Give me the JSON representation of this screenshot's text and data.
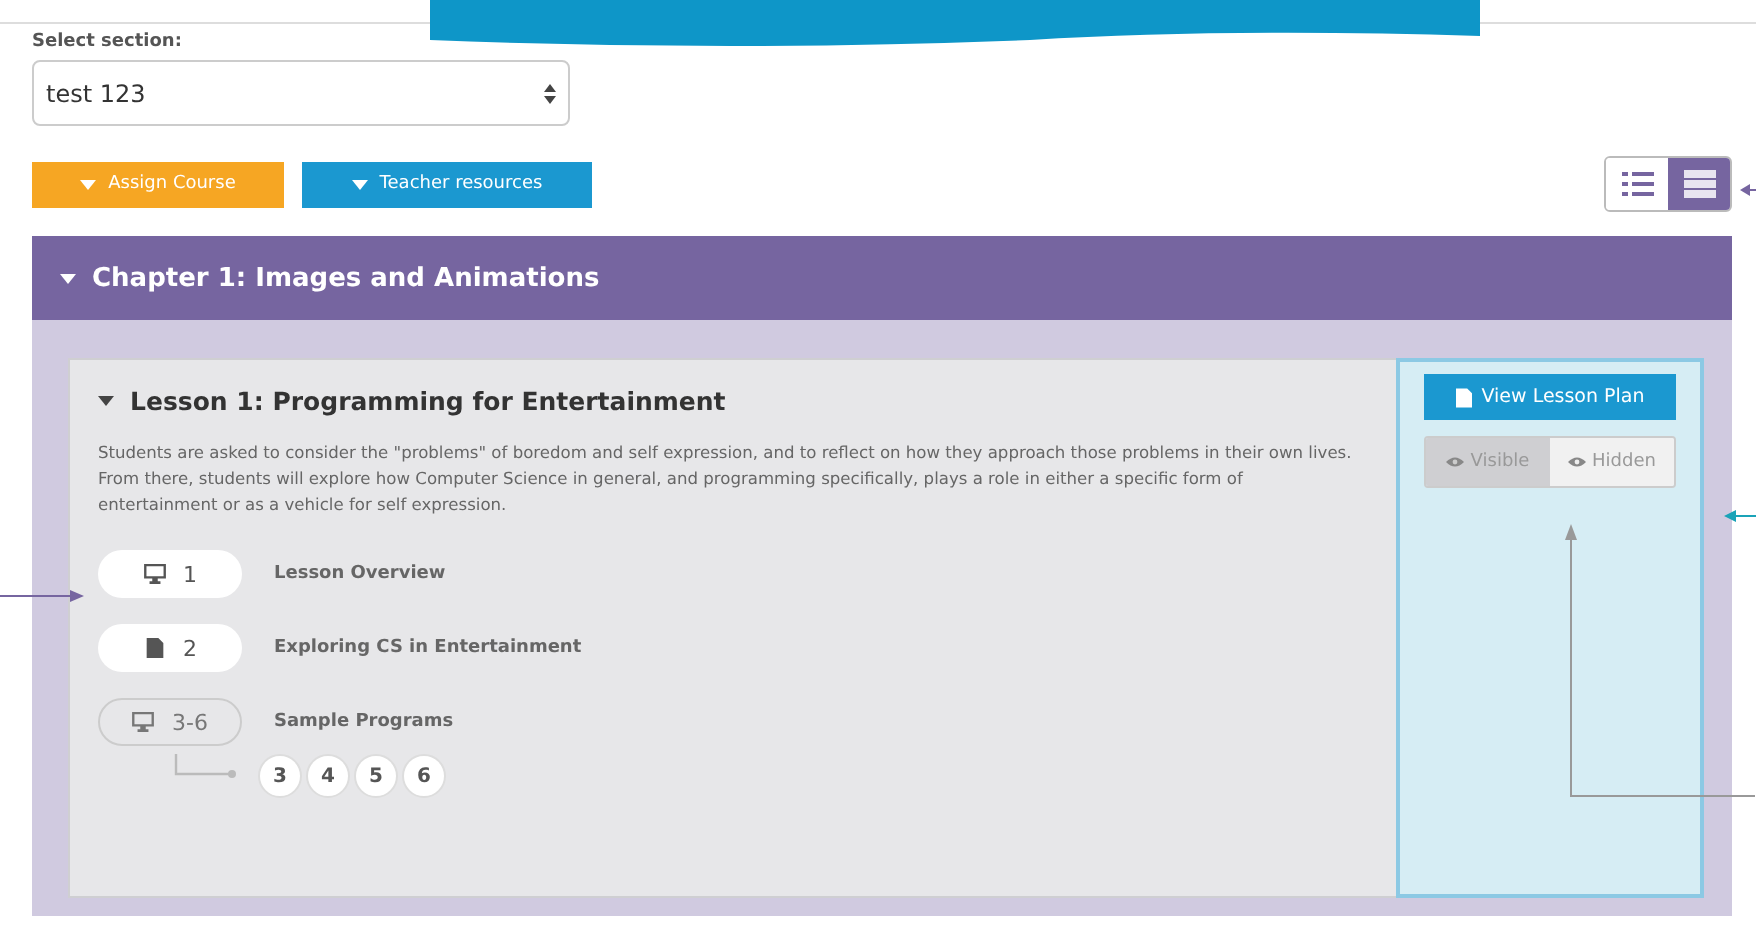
{
  "section_select": {
    "label": "Select section:",
    "value": "test 123"
  },
  "actions": [
    {
      "label": "Assign Course",
      "kind": "orange"
    },
    {
      "label": "Teacher resources",
      "kind": "blue"
    }
  ],
  "view_toggle": [
    {
      "kind": "list",
      "selected": false
    },
    {
      "kind": "detail",
      "selected": true
    }
  ],
  "chapter": {
    "title": "Chapter 1: Images and Animations",
    "expanded": true,
    "lesson": {
      "title": "Lesson 1: Programming for Entertainment",
      "expanded": true,
      "description": "Students are asked to consider the \"problems\" of boredom and self expression, and to reflect on how they approach those problems in their own lives. From there, students will explore how Computer Science in general, and programming specifically, plays a role in either a specific form of entertainment or as a vehicle for self expression.",
      "levels": [
        {
          "kind": "screen",
          "number": "1",
          "name": "Lesson Overview"
        },
        {
          "kind": "handout",
          "number": "2",
          "name": "Exploring CS in Entertainment"
        },
        {
          "kind": "group",
          "number": "3-6",
          "name": "Sample Programs",
          "bubbles": [
            "3",
            "4",
            "5",
            "6"
          ]
        }
      ],
      "plan_button": "View Lesson Plan",
      "visibility": [
        {
          "label": "Visible",
          "selected": true
        },
        {
          "label": "Hidden",
          "selected": false
        }
      ]
    }
  }
}
